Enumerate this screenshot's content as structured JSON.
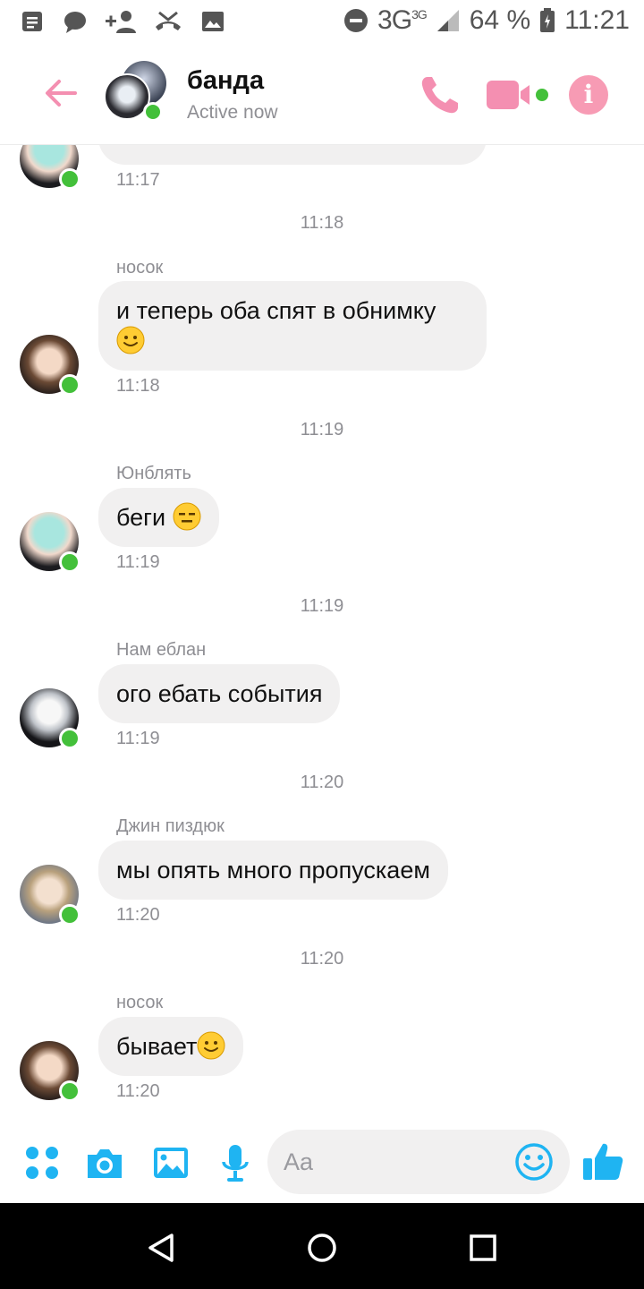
{
  "status_bar": {
    "network": "3G",
    "network_sup": "3G",
    "battery": "64 %",
    "time": "11:21",
    "icons": [
      "notes-icon",
      "chat-bubble-icon",
      "add-person-icon",
      "missed-call-icon",
      "image-icon",
      "do-not-disturb-icon",
      "signal-icon",
      "battery-icon"
    ]
  },
  "header": {
    "title": "банда",
    "subtitle": "Active now",
    "accent": "#f48fb1"
  },
  "messages": [
    {
      "type": "partial",
      "time": "11:17",
      "avatar": "mint"
    },
    {
      "type": "divider",
      "time": "11:18"
    },
    {
      "type": "message",
      "sender": "носок",
      "text": "и теперь оба спят в обнимку",
      "emoji": "slightly-smiling-face",
      "time": "11:18",
      "avatar": "brown"
    },
    {
      "type": "divider",
      "time": "11:19"
    },
    {
      "type": "message",
      "sender": "Юнблять",
      "text": "беги",
      "emoji": "expressionless-face",
      "time": "11:19",
      "avatar": "mint"
    },
    {
      "type": "divider",
      "time": "11:19"
    },
    {
      "type": "message",
      "sender": "Нам еблан",
      "text": "ого ебать события",
      "time": "11:19",
      "avatar": "white"
    },
    {
      "type": "divider",
      "time": "11:20"
    },
    {
      "type": "message",
      "sender": "Джин пиздюк",
      "text": "мы опять много пропускаем",
      "time": "11:20",
      "avatar": "light"
    },
    {
      "type": "divider",
      "time": "11:20"
    },
    {
      "type": "message",
      "sender": "носок",
      "text": "бывает",
      "emoji": "slightly-smiling-face",
      "time": "11:20",
      "avatar": "brown"
    }
  ],
  "composer": {
    "placeholder": "Aa",
    "accent": "#1fb4f2"
  }
}
